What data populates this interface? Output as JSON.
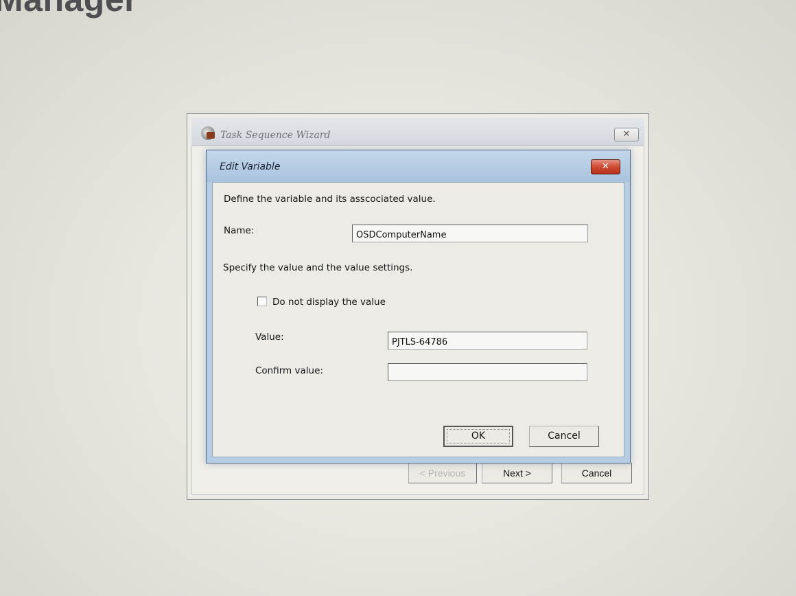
{
  "background": {
    "app_title": "Manager"
  },
  "wizard": {
    "title": "Task Sequence Wizard",
    "close_symbol": "✕",
    "buttons": {
      "previous": "< Previous",
      "next": "Next >",
      "cancel": "Cancel"
    }
  },
  "dialog": {
    "title": "Edit Variable",
    "close_symbol": "✕",
    "intro": "Define the variable and its asscociated value.",
    "name_label": "Name:",
    "name_value": "OSDComputerName",
    "settings_text": "Specify the value and the value settings.",
    "checkbox_label": "Do not display the value",
    "checkbox_checked": false,
    "value_label": "Value:",
    "value_value": "PJTLS-64786",
    "confirm_label": "Confirm value:",
    "confirm_value": "",
    "ok_label": "OK",
    "cancel_label": "Cancel"
  },
  "icons": [
    "task-sequence-wizard-icon",
    "close-icon"
  ]
}
